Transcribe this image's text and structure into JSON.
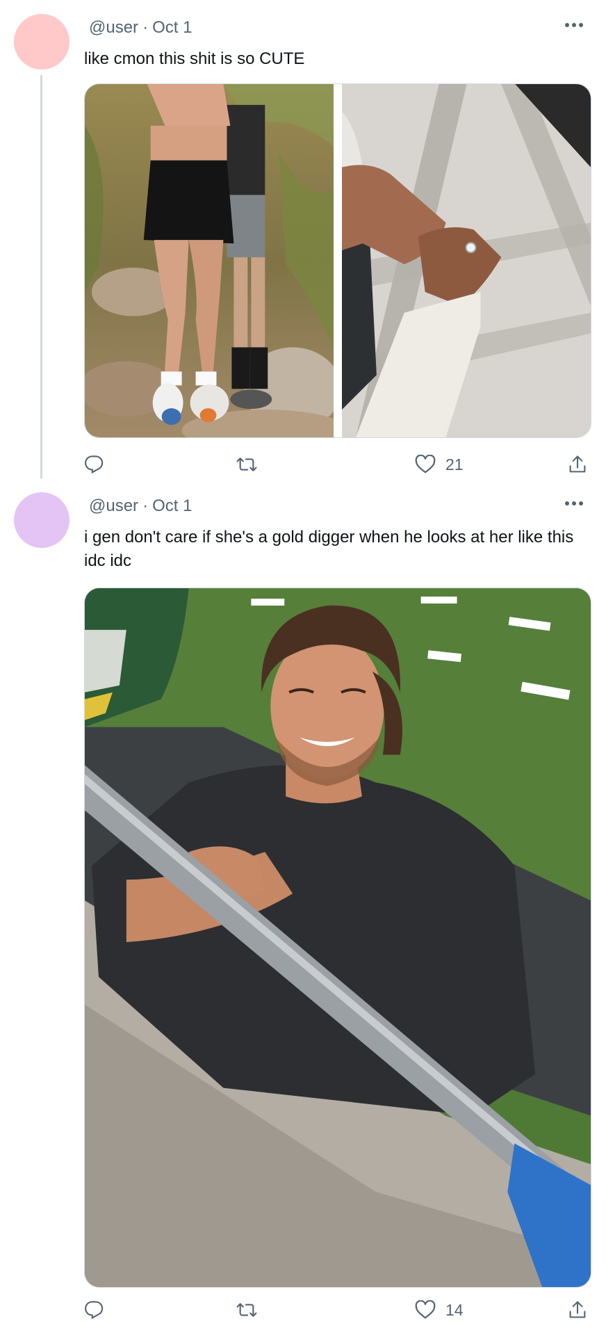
{
  "colors": {
    "avatar_1": "#ffc9c9",
    "avatar_2": "#e3c4f5",
    "secondary_text": "#536471",
    "border": "#cfd9de"
  },
  "tweets": [
    {
      "handle": "@user",
      "date": "Oct 1",
      "separator": "·",
      "text": "like cmon this shit is so CUTE",
      "media_icons": [
        "couple-hugging-photo",
        "ring-hands-photo"
      ],
      "likes": "21",
      "icons": {
        "reply": "reply-icon",
        "retweet": "retweet-icon",
        "like": "heart-icon",
        "share": "share-icon",
        "more": "more-icon"
      }
    },
    {
      "handle": "@user",
      "date": "Oct 1",
      "separator": "·",
      "text": "i gen don't care if she's a gold digger when he looks at her like this idc idc",
      "media_icons": [
        "smiling-man-photo"
      ],
      "likes": "14",
      "icons": {
        "reply": "reply-icon",
        "retweet": "retweet-icon",
        "like": "heart-icon",
        "share": "share-icon",
        "more": "more-icon"
      }
    }
  ]
}
